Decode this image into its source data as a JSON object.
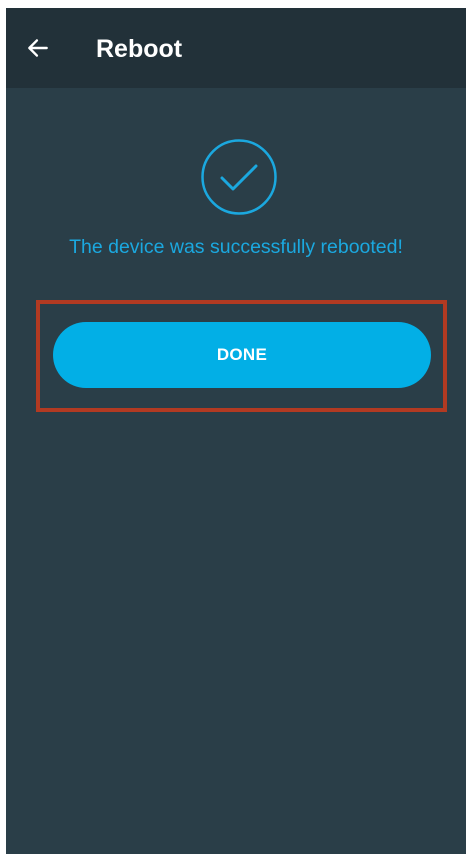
{
  "header": {
    "title": "Reboot",
    "back_icon": "arrow-left-icon"
  },
  "status": {
    "icon": "check-circle-icon",
    "message": "The device was successfully rebooted!"
  },
  "actions": {
    "done_label": "DONE"
  },
  "colors": {
    "background": "#2a3e48",
    "app_bar": "#223139",
    "accent": "#02afe6",
    "highlight_border": "#b23a22"
  }
}
